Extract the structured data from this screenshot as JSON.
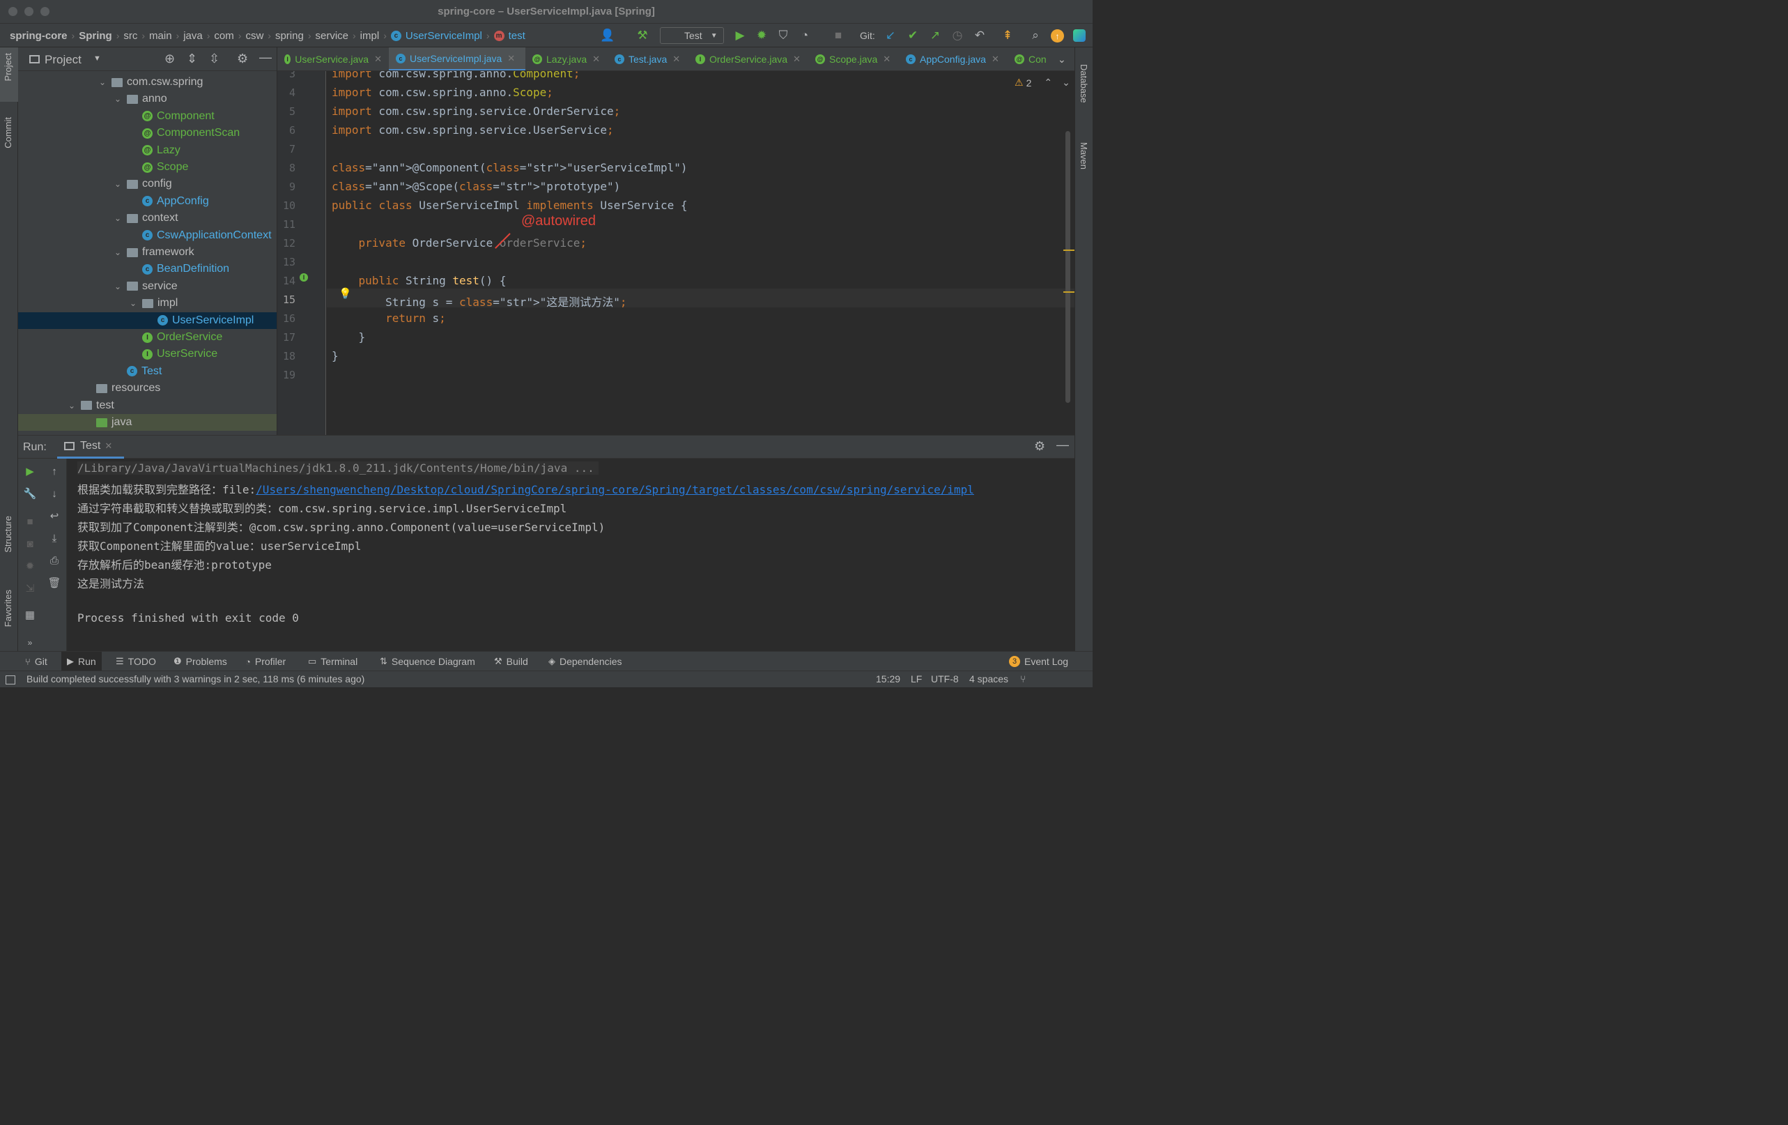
{
  "window": {
    "title": "spring-core – UserServiceImpl.java [Spring]"
  },
  "breadcrumbs": [
    "spring-core",
    "Spring",
    "src",
    "main",
    "java",
    "com",
    "csw",
    "spring",
    "service",
    "impl",
    "UserServiceImpl",
    "test"
  ],
  "toolbar": {
    "run_config": "Test",
    "git_label": "Git:"
  },
  "left_strip": {
    "project": "Project",
    "commit": "Commit",
    "structure": "Structure",
    "favorites": "Favorites"
  },
  "right_strip": {
    "database": "Database",
    "maven": "Maven"
  },
  "project_panel": {
    "title": "Project",
    "tree": [
      {
        "label": "com.csw.spring",
        "kind": "package",
        "depth": 0,
        "expanded": true
      },
      {
        "label": "anno",
        "kind": "package",
        "depth": 1,
        "expanded": true
      },
      {
        "label": "Component",
        "kind": "annotation",
        "depth": 2
      },
      {
        "label": "ComponentScan",
        "kind": "annotation",
        "depth": 2
      },
      {
        "label": "Lazy",
        "kind": "annotation",
        "depth": 2
      },
      {
        "label": "Scope",
        "kind": "annotation",
        "depth": 2
      },
      {
        "label": "config",
        "kind": "package",
        "depth": 1,
        "expanded": true
      },
      {
        "label": "AppConfig",
        "kind": "class",
        "depth": 2
      },
      {
        "label": "context",
        "kind": "package",
        "depth": 1,
        "expanded": true
      },
      {
        "label": "CswApplicationContext",
        "kind": "class",
        "depth": 2
      },
      {
        "label": "framework",
        "kind": "package",
        "depth": 1,
        "expanded": true
      },
      {
        "label": "BeanDefinition",
        "kind": "class",
        "depth": 2
      },
      {
        "label": "service",
        "kind": "package",
        "depth": 1,
        "expanded": true
      },
      {
        "label": "impl",
        "kind": "package",
        "depth": 2,
        "expanded": true
      },
      {
        "label": "UserServiceImpl",
        "kind": "class",
        "depth": 3,
        "selected": true
      },
      {
        "label": "OrderService",
        "kind": "interface",
        "depth": 2
      },
      {
        "label": "UserService",
        "kind": "interface",
        "depth": 2
      },
      {
        "label": "Test",
        "kind": "class",
        "depth": 1
      },
      {
        "label": "resources",
        "kind": "folder",
        "depth": -1
      },
      {
        "label": "test",
        "kind": "folder",
        "depth": -2,
        "expanded": true
      },
      {
        "label": "java",
        "kind": "source",
        "depth": -1
      }
    ]
  },
  "editor_tabs": [
    {
      "label": "UserService.java",
      "kind": "interface"
    },
    {
      "label": "UserServiceImpl.java",
      "kind": "class",
      "active": true
    },
    {
      "label": "Lazy.java",
      "kind": "annotation"
    },
    {
      "label": "Test.java",
      "kind": "class"
    },
    {
      "label": "OrderService.java",
      "kind": "interface"
    },
    {
      "label": "Scope.java",
      "kind": "annotation"
    },
    {
      "label": "AppConfig.java",
      "kind": "class"
    },
    {
      "label": "Con",
      "kind": "annotation"
    }
  ],
  "editor": {
    "warnings": "2",
    "current_line": 15,
    "annotation_note": "@autowired",
    "lines": [
      {
        "n": "3",
        "text": "import com.csw.spring.anno.Component;"
      },
      {
        "n": "4",
        "text": "import com.csw.spring.anno.Scope;"
      },
      {
        "n": "5",
        "text": "import com.csw.spring.service.OrderService;"
      },
      {
        "n": "6",
        "text": "import com.csw.spring.service.UserService;"
      },
      {
        "n": "7",
        "text": ""
      },
      {
        "n": "8",
        "text": "@Component(\"userServiceImpl\")"
      },
      {
        "n": "9",
        "text": "@Scope(\"prototype\")"
      },
      {
        "n": "10",
        "text": "public class UserServiceImpl implements UserService {"
      },
      {
        "n": "11",
        "text": ""
      },
      {
        "n": "12",
        "text": "    private OrderService orderService;"
      },
      {
        "n": "13",
        "text": ""
      },
      {
        "n": "14",
        "text": "    public String test() {"
      },
      {
        "n": "15",
        "text": "        String s = \"这是测试方法\";"
      },
      {
        "n": "16",
        "text": "        return s;"
      },
      {
        "n": "17",
        "text": "    }"
      },
      {
        "n": "18",
        "text": "}"
      },
      {
        "n": "19",
        "text": ""
      }
    ]
  },
  "run_panel": {
    "label": "Run:",
    "tab": "Test",
    "console": [
      "/Library/Java/JavaVirtualMachines/jdk1.8.0_211.jdk/Contents/Home/bin/java ...",
      "根据类加载获取到完整路径：file:",
      "通过字符串截取和转义替换或取到的类：com.csw.spring.service.impl.UserServiceImpl",
      "获取到加了Component注解到类：@com.csw.spring.anno.Component(value=userServiceImpl)",
      "获取Component注解里面的value：userServiceImpl",
      "存放解析后的bean缓存池:prototype",
      "这是测试方法",
      "",
      "Process finished with exit code 0"
    ],
    "console_link": "/Users/shengwencheng/Desktop/cloud/SpringCore/spring-core/Spring/target/classes/com/csw/spring/service/impl"
  },
  "bottom_tools": [
    {
      "label": "Git",
      "icon": "git-icon"
    },
    {
      "label": "Run",
      "icon": "run-icon",
      "active": true
    },
    {
      "label": "TODO",
      "icon": "todo-icon"
    },
    {
      "label": "Problems",
      "icon": "problems-icon"
    },
    {
      "label": "Profiler",
      "icon": "profiler-icon"
    },
    {
      "label": "Terminal",
      "icon": "terminal-icon"
    },
    {
      "label": "Sequence Diagram",
      "icon": "sequence-icon"
    },
    {
      "label": "Build",
      "icon": "build-icon"
    },
    {
      "label": "Dependencies",
      "icon": "dependencies-icon"
    }
  ],
  "event_log": {
    "label": "Event Log",
    "count": "3"
  },
  "status": {
    "message": "Build completed successfully with 3 warnings in 2 sec, 118 ms (6 minutes ago)",
    "position": "15:29",
    "line_sep": "LF",
    "encoding": "UTF-8",
    "indent": "4 spaces"
  },
  "colors": {
    "accent": "#4a88c7",
    "selection": "#0d293e",
    "class_icon": "#3592c4",
    "anno_icon": "#62b543",
    "keyword": "#cc7832",
    "string": "#6a8759",
    "annotation": "#bbb529",
    "note_red": "#e0443a"
  }
}
